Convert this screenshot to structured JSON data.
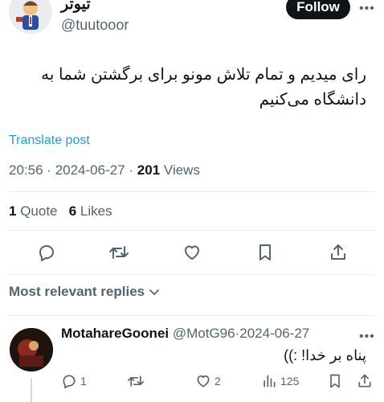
{
  "author": {
    "name": "تیوتر",
    "handle": "@tuutooor",
    "follow_label": "Follow"
  },
  "post": {
    "text": "رای میدیم و تمام تلاش مونو برای برگشتن شما به دانشگاه می‌کنیم",
    "translate_label": "Translate post",
    "time": "20:56",
    "date": "2024-06-27",
    "views_count": "201",
    "views_label": "Views",
    "quotes_count": "1",
    "quotes_label": "Quote",
    "likes_count": "6",
    "likes_label": "Likes"
  },
  "replies_sort_label": "Most relevant replies",
  "reply": {
    "name": "MotahareGoonei",
    "handle": "@MotG96",
    "date": "2024-06-27",
    "text": "پناه بر خدا! :))",
    "reply_count": "1",
    "like_count": "2",
    "view_count": "125"
  },
  "colors": {
    "accent": "#1d9bf0",
    "muted": "#536471",
    "text": "#0f1419"
  },
  "icons": [
    "reply-icon",
    "retweet-icon",
    "heart-icon",
    "bookmark-icon",
    "share-icon",
    "chevron-down-icon",
    "views-icon",
    "more-icon"
  ]
}
